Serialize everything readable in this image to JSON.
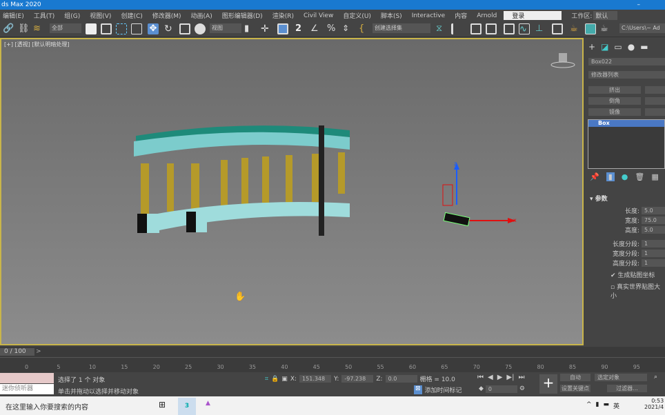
{
  "window": {
    "title": "ds Max 2020",
    "minimize": "–"
  },
  "menu": [
    "编辑(E)",
    "工具(T)",
    "组(G)",
    "视图(V)",
    "创建(C)",
    "修改器(M)",
    "动画(A)",
    "图形编辑器(D)",
    "渲染(R)",
    "Civil View",
    "自定义(U)",
    "脚本(S)",
    "Interactive",
    "内容",
    "Arnold"
  ],
  "login": "登录",
  "workspace_label": "工作区:",
  "workspace": "默认",
  "toolbar": {
    "filter": "全部",
    "refcoord": "视图",
    "selset": "创建选择集",
    "path": "C:\\Users\\~ Ad"
  },
  "viewport": {
    "label": "[+] [透视] [默认明暗处理]",
    "axis_z": "z",
    "axis_x": "x"
  },
  "panel": {
    "object_name": "Box022",
    "modifier_list": "修改器列表",
    "buttons": [
      "挤出",
      "倒角",
      "镜像"
    ],
    "stack": [
      "Box"
    ],
    "rollout": "参数",
    "params": [
      {
        "label": "长度:",
        "value": "5.0"
      },
      {
        "label": "宽度:",
        "value": "75.0"
      },
      {
        "label": "高度:",
        "value": "5.0"
      },
      {
        "label": "长度分段:",
        "value": "1"
      },
      {
        "label": "宽度分段:",
        "value": "1"
      },
      {
        "label": "高度分段:",
        "value": "1"
      }
    ],
    "gen_map": "生成贴图坐标",
    "real_world": "真实世界贴图大小"
  },
  "time": {
    "slider": "0 / 100",
    "ticks": [
      "0",
      "5",
      "10",
      "15",
      "20",
      "25",
      "30",
      "35",
      "40",
      "45",
      "50",
      "55",
      "60",
      "65",
      "70",
      "75",
      "80",
      "85",
      "90",
      "95"
    ]
  },
  "status": {
    "listener": "迷你侦听器",
    "selected": "选择了 1 个 对象",
    "prompt": "单击并拖动以选择并移动对象",
    "x_label": "X:",
    "x": "151.348",
    "y_label": "Y:",
    "y": "-97.238",
    "z_label": "Z:",
    "z": "0.0",
    "grid": "栅格 = 10.0",
    "add_tag": "添加时间标记",
    "auto": "自动",
    "selected_obj": "选定对象",
    "set_key": "设置关键点",
    "filters": "过滤器...",
    "frame": "0"
  },
  "taskbar": {
    "search": "在这里输入你要搜索的内容",
    "time": "0:53",
    "date": "2021/4",
    "lang": "英"
  }
}
